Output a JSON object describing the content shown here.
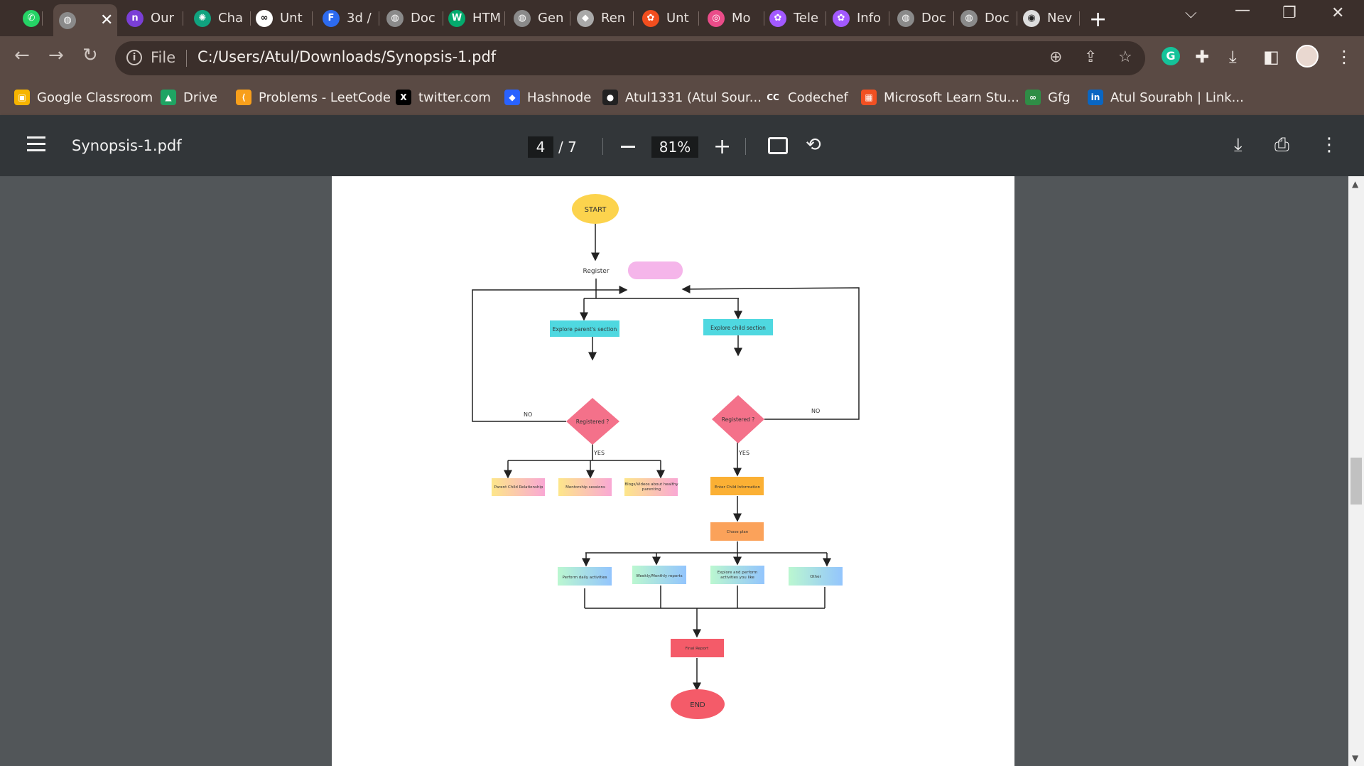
{
  "browser": {
    "tabs": [
      {
        "label": "",
        "icon": "whatsapp-icon",
        "color": "#25d366",
        "glyph": "✆"
      },
      {
        "label": "",
        "icon": "globe-icon",
        "color": "#8a8a8a",
        "glyph": "◍",
        "active": true
      },
      {
        "label": "Our",
        "icon": "njoy-icon",
        "color": "#7a3fd6",
        "glyph": "n"
      },
      {
        "label": "Cha",
        "icon": "chatgpt-icon",
        "color": "#10a37f",
        "glyph": "✺"
      },
      {
        "label": "Unt",
        "icon": "codechef-icon",
        "color": "#ffffff",
        "glyph": "∞"
      },
      {
        "label": "3d /",
        "icon": "forms-icon",
        "color": "#2d6bf0",
        "glyph": "F"
      },
      {
        "label": "Doc",
        "icon": "globe-icon",
        "color": "#8a8a8a",
        "glyph": "◍"
      },
      {
        "label": "HTM",
        "icon": "w3schools-icon",
        "color": "#04aa6d",
        "glyph": "W"
      },
      {
        "label": "Gen",
        "icon": "globe-icon",
        "color": "#8a8a8a",
        "glyph": "◍"
      },
      {
        "label": "Ren",
        "icon": "render-icon",
        "color": "#a9a9a9",
        "glyph": "◆"
      },
      {
        "label": "Unt",
        "icon": "figma-icon",
        "color": "#f24e1e",
        "glyph": "✿"
      },
      {
        "label": "Mo",
        "icon": "dribbble-icon",
        "color": "#ea4c89",
        "glyph": "◎"
      },
      {
        "label": "Tele",
        "icon": "figma-icon",
        "color": "#a259ff",
        "glyph": "✿"
      },
      {
        "label": "Info",
        "icon": "figma-icon",
        "color": "#a259ff",
        "glyph": "✿"
      },
      {
        "label": "Doc",
        "icon": "globe-icon",
        "color": "#8a8a8a",
        "glyph": "◍"
      },
      {
        "label": "Doc",
        "icon": "globe-icon",
        "color": "#8a8a8a",
        "glyph": "◍"
      },
      {
        "label": "Nev",
        "icon": "chrome-icon",
        "color": "#dddddd",
        "glyph": "◉"
      }
    ],
    "address": {
      "scheme_label": "File",
      "url": "C:/Users/Atul/Downloads/Synopsis-1.pdf"
    },
    "bookmarks": [
      {
        "label": "Google Classroom",
        "icon": "google-classroom-icon",
        "color": "#f6b400",
        "glyph": "▣"
      },
      {
        "label": "Drive",
        "icon": "google-drive-icon",
        "color": "#1fa463",
        "glyph": "▲"
      },
      {
        "label": "Problems - LeetCode",
        "icon": "leetcode-icon",
        "color": "#f89f1b",
        "glyph": "⟨"
      },
      {
        "label": "twitter.com",
        "icon": "x-icon",
        "color": "#000000",
        "glyph": "X"
      },
      {
        "label": "Hashnode",
        "icon": "hashnode-icon",
        "color": "#2962ff",
        "glyph": "◆"
      },
      {
        "label": "Atul1331 (Atul Sour...",
        "icon": "github-icon",
        "color": "#222222",
        "glyph": "●"
      },
      {
        "label": "Codechef",
        "icon": "codechef-icon",
        "color": "#5a4a44",
        "glyph": "CC"
      },
      {
        "label": "Microsoft Learn Stu...",
        "icon": "microsoft-icon",
        "color": "#f25022",
        "glyph": "▦"
      },
      {
        "label": "Gfg",
        "icon": "geeksforgeeks-icon",
        "color": "#2f8d46",
        "glyph": "∞"
      },
      {
        "label": "Atul Sourabh | Link...",
        "icon": "linkedin-icon",
        "color": "#0a66c2",
        "glyph": "in"
      }
    ]
  },
  "pdf": {
    "title": "Synopsis-1.pdf",
    "current_page": "4",
    "total_pages": "/ 7",
    "zoom": "81%"
  },
  "flowchart": {
    "start": "START",
    "register": "Register",
    "parent_section": "Explore parent's section",
    "child_section": "Explore child section",
    "registered_left": "Registered ?",
    "registered_right": "Registered ?",
    "no_left": "NO",
    "no_right": "NO",
    "yes_left": "YES",
    "yes_right": "YES",
    "parent_child_relationship": "Parent Child Relationship",
    "mentorship": "Mentorship sessions",
    "blogs_line1": "Blogs/Videos about healthy",
    "blogs_line2": "parenting",
    "enter_child_info": "Enter Child Information",
    "chose_plan": "Chose plan",
    "daily_activities": "Perform daily activities",
    "reports": "Weekly/Monthly reports",
    "explore_line1": "Explore and perform",
    "explore_line2": "activities you like",
    "other": "Other",
    "final_report": "Final Report",
    "end": "END"
  }
}
